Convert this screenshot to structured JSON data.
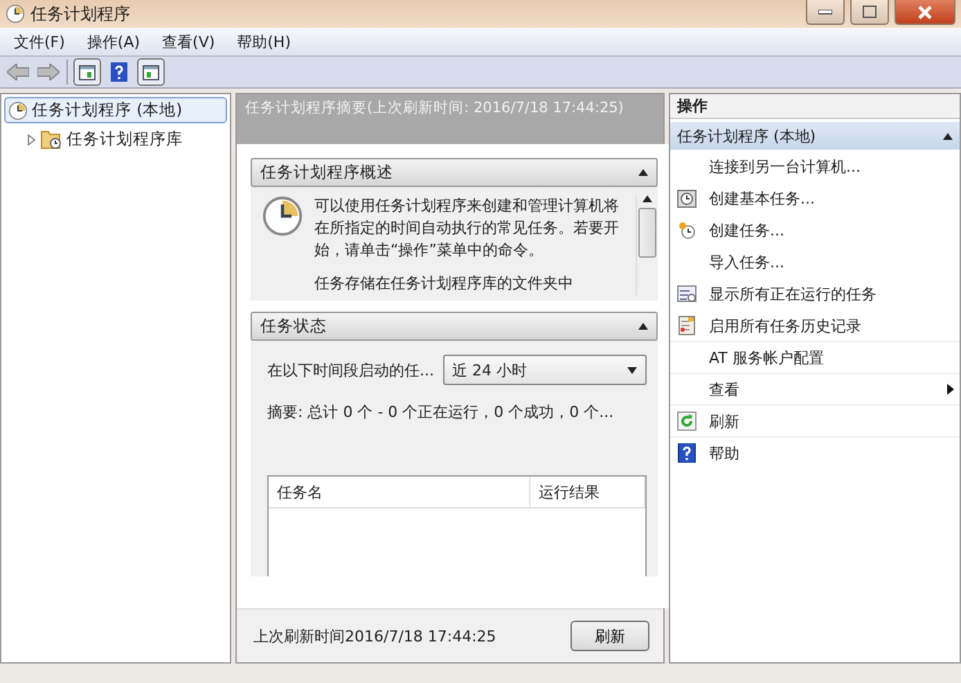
{
  "window": {
    "title": "任务计划程序"
  },
  "menu": [
    "文件(F)",
    "操作(A)",
    "查看(V)",
    "帮助(H)"
  ],
  "tree": [
    {
      "label": "任务计划程序 (本地)",
      "selected": true,
      "children": [
        {
          "label": "任务计划程序库",
          "expanded": false
        }
      ]
    }
  ],
  "summary": {
    "title": "任务计划程序摘要(上次刷新时间: 2016/7/18 17:44:25)",
    "overview": {
      "title": "任务计划程序概述",
      "paragraphs": [
        "可以使用任务计划程序来创建和管理计算机将在所指定的时间自动执行的常见任务。若要开始，请单击“操作”菜单中的命令。",
        "任务存储在任务计划程序库的文件夹中"
      ]
    },
    "status": {
      "title": "任务状态",
      "period_label": "在以下时间段启动的任...",
      "period_value": "近 24 小时",
      "summary": "摘要: 总计 0 个 - 0 个正在运行，0 个成功，0 个...",
      "columns": [
        "任务名",
        "运行结果"
      ]
    },
    "refreshed": "上次刷新时间2016/7/18 17:44:25",
    "refresh_button": "刷新"
  },
  "actions": {
    "title": "操作",
    "group": "任务计划程序 (本地)",
    "items": [
      {
        "label": "连接到另一台计算机...",
        "kind": "command"
      },
      {
        "label": "创建基本任务...",
        "kind": "command"
      },
      {
        "label": "创建任务...",
        "kind": "command"
      },
      {
        "label": "导入任务...",
        "kind": "command"
      },
      {
        "label": "显示所有正在运行的任务",
        "kind": "command"
      },
      {
        "label": "启用所有任务历史记录",
        "kind": "command"
      },
      {
        "label": "AT 服务帐户配置",
        "kind": "command"
      },
      {
        "label": "查看",
        "kind": "submenu"
      },
      {
        "label": "刷新",
        "kind": "command"
      },
      {
        "label": "帮助",
        "kind": "command"
      }
    ]
  }
}
